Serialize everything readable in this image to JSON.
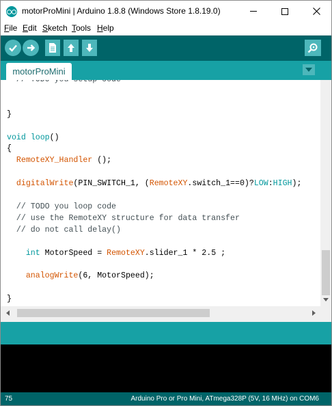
{
  "window": {
    "title": "motorProMini | Arduino 1.8.8 (Windows Store 1.8.19.0)"
  },
  "menu": {
    "items": [
      {
        "label": "File",
        "underline": "F",
        "rest": "ile"
      },
      {
        "label": "Edit",
        "underline": "E",
        "rest": "dit"
      },
      {
        "label": "Sketch",
        "underline": "S",
        "rest": "ketch"
      },
      {
        "label": "Tools",
        "underline": "T",
        "rest": "ools"
      },
      {
        "label": "Help",
        "underline": "H",
        "rest": "elp"
      }
    ]
  },
  "toolbar": {
    "buttons": [
      "verify-icon",
      "upload-icon",
      "new-icon",
      "open-icon",
      "save-icon",
      "serial-monitor-icon"
    ]
  },
  "tabs": {
    "active": "motorProMini"
  },
  "code": {
    "lines": [
      "  // TODO you setup code",
      "",
      "",
      "}",
      "",
      "void loop()",
      "{",
      "  RemoteXY_Handler ();",
      "",
      "  digitalWrite(PIN_SWITCH_1, (RemoteXY.switch_1==0)?LOW:HIGH);",
      "",
      "  // TODO you loop code",
      "  // use the RemoteXY structure for data transfer",
      "  // do not call delay()",
      "",
      "    int MotorSpeed = RemoteXY.slider_1 * 2.5 ;",
      "",
      "    analogWrite(6, MotorSpeed);",
      "",
      "}"
    ]
  },
  "footer": {
    "line_number": "75",
    "board": "Arduino Pro or Pro Mini, ATmega328P (5V, 16 MHz) on COM6"
  },
  "colors": {
    "toolbar": "#006468",
    "tabstrip": "#17a1a5",
    "keyword": "#00979c",
    "function": "#d35400"
  }
}
